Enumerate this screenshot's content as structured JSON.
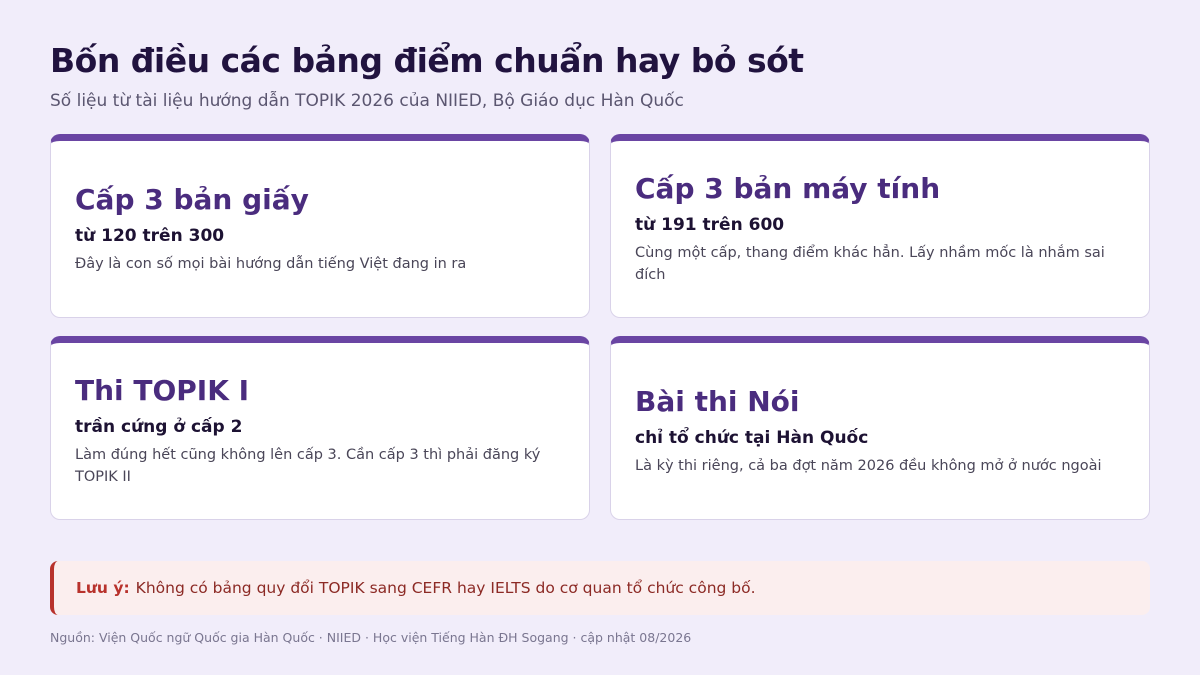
{
  "header": {
    "title": "Bốn điều các bảng điểm chuẩn hay bỏ sót",
    "subtitle": "Số liệu từ tài liệu hướng dẫn TOPIK 2026 của NIIED, Bộ Giáo dục Hàn Quốc"
  },
  "cards": [
    {
      "title": "Cấp 3 bản giấy",
      "sub": "từ 120 trên 300",
      "desc": "Đây là con số mọi bài hướng dẫn tiếng Việt đang in ra"
    },
    {
      "title": "Cấp 3 bản máy tính",
      "sub": "từ 191 trên 600",
      "desc": "Cùng một cấp, thang điểm khác hẳn. Lấy nhầm mốc là nhắm sai đích"
    },
    {
      "title": "Thi TOPIK I",
      "sub": "trần cứng ở cấp 2",
      "desc": "Làm đúng hết cũng không lên cấp 3. Cần cấp 3 thì phải đăng ký TOPIK II"
    },
    {
      "title": "Bài thi Nói",
      "sub": "chỉ tổ chức tại Hàn Quốc",
      "desc": "Là kỳ thi riêng, cả ba đợt năm 2026 đều không mở ở nước ngoài"
    }
  ],
  "note": {
    "label": "Lưu ý:",
    "text": "Không có bảng quy đổi TOPIK sang CEFR hay IELTS do cơ quan tổ chức công bố."
  },
  "source": "Nguồn: Viện Quốc ngữ Quốc gia Hàn Quốc · NIIED · Học viện Tiếng Hàn ĐH Sogang · cập nhật 08/2026",
  "colors": {
    "background": "#f1edfa",
    "accent": "#6a45a3",
    "card_title": "#4a2c7e",
    "note_bg": "#fbeeee",
    "note_accent": "#b8322c"
  }
}
